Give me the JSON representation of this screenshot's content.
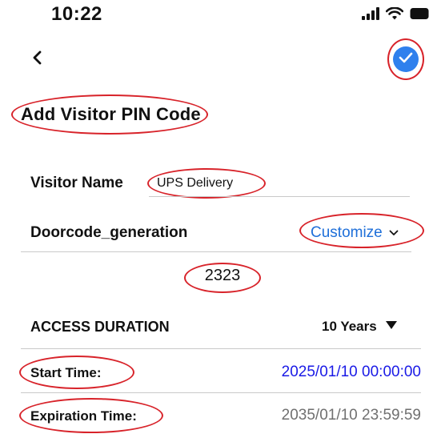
{
  "status_bar": {
    "time": "10:22",
    "icons": [
      "cellular-signal-icon",
      "wifi-icon",
      "battery-icon"
    ]
  },
  "nav": {
    "back_icon": "chevron-left-icon",
    "confirm_icon": "checkmark-icon",
    "confirm_color": "#2f80ed"
  },
  "page": {
    "title": "Add Visitor PIN Code"
  },
  "form": {
    "visitor_name_label": "Visitor Name",
    "visitor_name_value": "UPS Delivery",
    "doorcode_label": "Doorcode_generation",
    "doorcode_mode": "Customize",
    "code_value": "2323",
    "access_duration_label": "ACCESS DURATION",
    "access_duration_value": "10 Years",
    "start_time_label": "Start Time:",
    "start_time_value": "2025/01/10 00:00:00",
    "expiration_time_label": "Expiration Time:",
    "expiration_time_value": "2035/01/10 23:59:59"
  },
  "colors": {
    "accent_blue": "#1e6fd9",
    "start_time_blue": "#1a1ae6",
    "annotation_red": "#d8232a",
    "muted_gray": "#707070"
  }
}
